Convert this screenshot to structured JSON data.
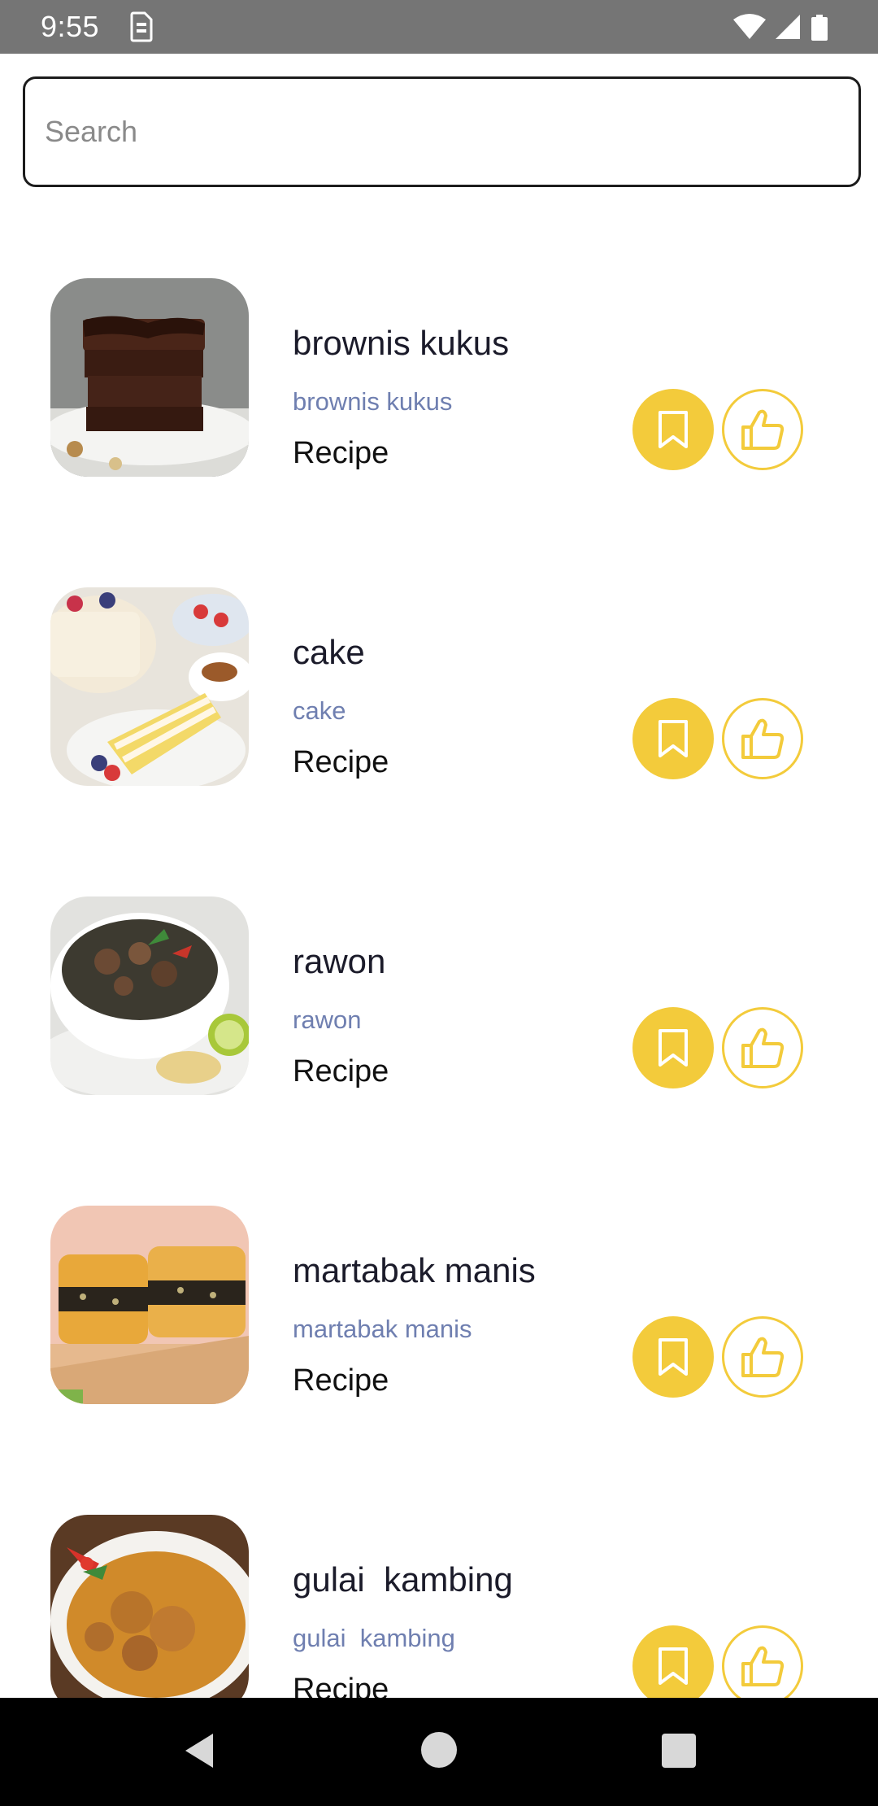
{
  "status_bar": {
    "time": "9:55",
    "icons": [
      "sim-card-icon",
      "wifi-icon",
      "signal-icon",
      "battery-icon"
    ]
  },
  "search": {
    "placeholder": "Search",
    "value": ""
  },
  "colors": {
    "accent": "#f3cb3b",
    "title": "#1b1b2a",
    "subtitle": "#6f7fb0",
    "status_bar": "#757575",
    "nav_bar": "#000000"
  },
  "recipes": [
    {
      "title": "brownis kukus",
      "subtitle": "brownis kukus",
      "type": "Recipe",
      "image": "brownie-photo"
    },
    {
      "title": "cake",
      "subtitle": "cake",
      "type": "Recipe",
      "image": "cake-photo"
    },
    {
      "title": "rawon",
      "subtitle": "rawon",
      "type": "Recipe",
      "image": "rawon-soup-photo"
    },
    {
      "title": "martabak manis",
      "subtitle": "martabak manis",
      "type": "Recipe",
      "image": "martabak-photo"
    },
    {
      "title": "gulai  kambing",
      "subtitle": "gulai  kambing",
      "type": "Recipe",
      "image": "gulai-curry-photo"
    }
  ],
  "nav": {
    "icons": [
      "back-icon",
      "home-icon",
      "recents-icon"
    ]
  }
}
